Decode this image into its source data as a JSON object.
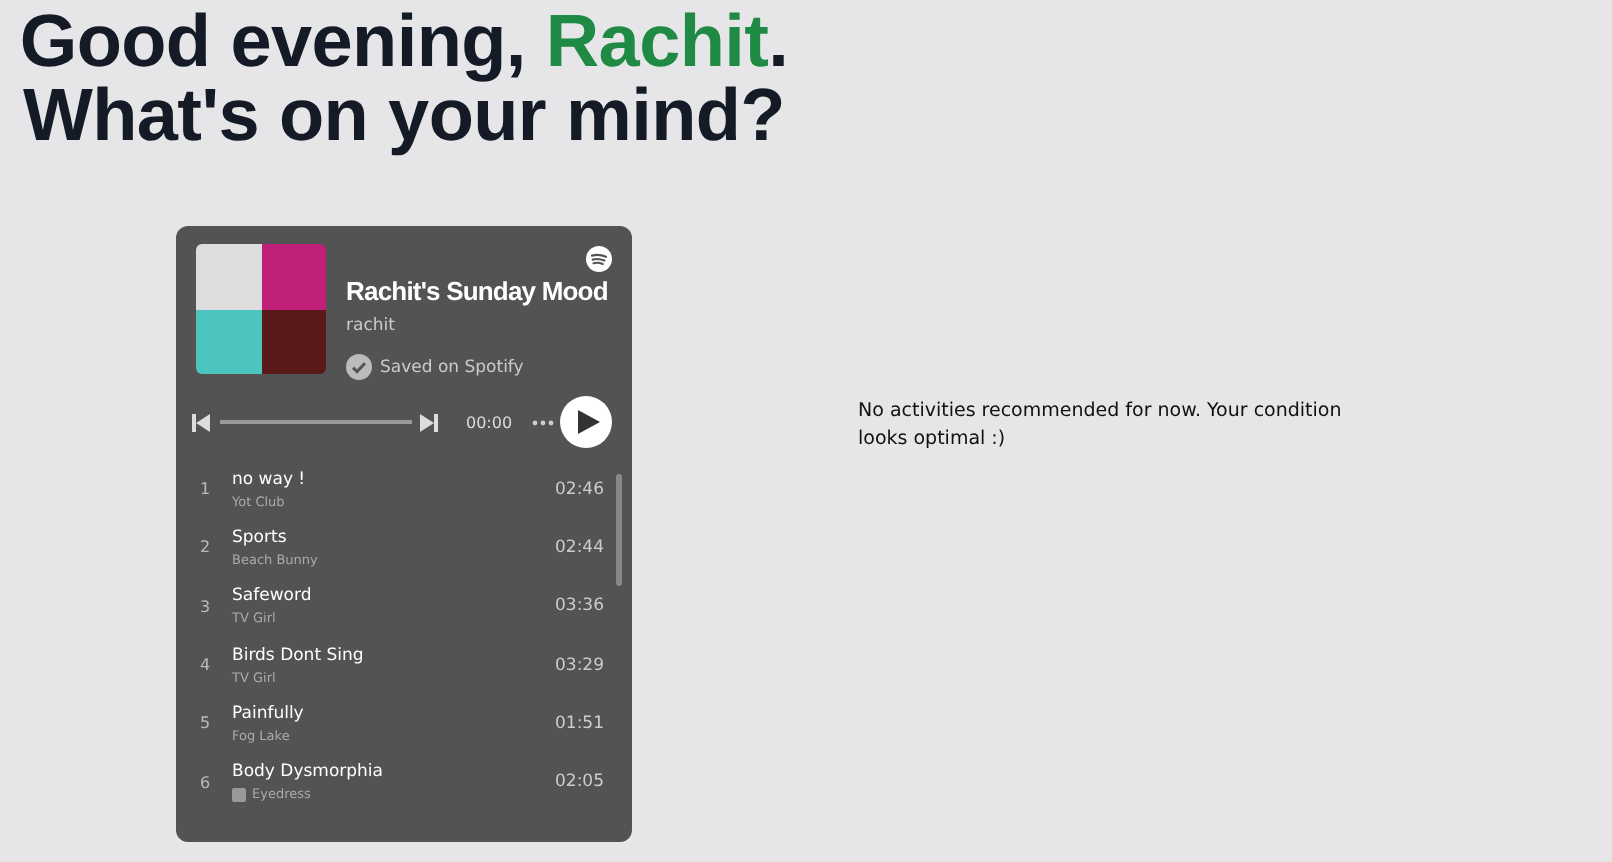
{
  "heading": {
    "greeting": "Good evening,",
    "name": "Rachit",
    "end": ".",
    "question": "What's on your mind?"
  },
  "playlist": {
    "title": "Rachit's Sunday Mood",
    "owner": "rachit",
    "saved_label": "Saved on Spotify",
    "time": "00:00",
    "tracks": [
      {
        "number": "1",
        "title": "no way !",
        "artist": "Yot Club",
        "duration": "02:46",
        "explicit": false
      },
      {
        "number": "2",
        "title": "Sports",
        "artist": "Beach Bunny",
        "duration": "02:44",
        "explicit": false
      },
      {
        "number": "3",
        "title": "Safeword",
        "artist": "TV Girl",
        "duration": "03:36",
        "explicit": false
      },
      {
        "number": "4",
        "title": "Birds Dont Sing",
        "artist": "TV Girl",
        "duration": "03:29",
        "explicit": false
      },
      {
        "number": "5",
        "title": "Painfully",
        "artist": "Fog Lake",
        "duration": "01:51",
        "explicit": false
      },
      {
        "number": "6",
        "title": "Body Dysmorphia",
        "artist": "Eyedress",
        "duration": "02:05",
        "explicit": true
      }
    ]
  },
  "recommendation": "No activities recommended for now. Your condition looks optimal :)"
}
